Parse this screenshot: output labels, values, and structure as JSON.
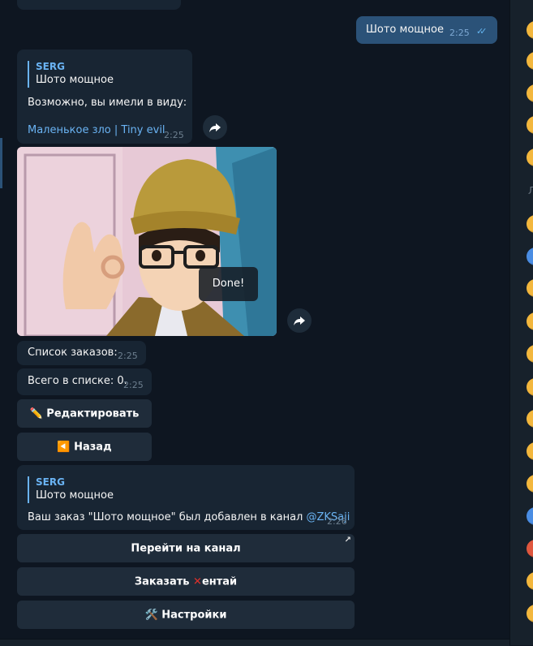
{
  "messages": {
    "out1": {
      "text": "Шото мощное",
      "time": "2:25"
    },
    "bot1": {
      "reply_name": "SERG",
      "reply_text": "Шото мощное",
      "text": "Возможно, вы имели в виду:",
      "link": "Маленькое зло | Tiny evil",
      "time": "2:25"
    },
    "photo": {
      "toast": "Done!"
    },
    "list1": {
      "text": "Список заказов:",
      "time": "2:25"
    },
    "list2": {
      "text": "Всего в списке: 0.",
      "time": "2:25"
    },
    "bot2": {
      "reply_name": "SERG",
      "reply_text": "Шото мощное",
      "text_prefix": "Ваш заказ \"Шото мощное\" был добавлен в канал ",
      "mention": "@ZKSaji",
      "time": "2:26"
    }
  },
  "keyboard1": {
    "edit": "✏️ Редактировать",
    "back": "◀️ Назад"
  },
  "keyboard2": {
    "go_channel": "Перейти на канал",
    "order_prefix": "Заказать ",
    "order_suffix": "ентай",
    "settings": "🛠️ Настройки"
  },
  "side": {
    "letter": "Л"
  },
  "colors": {
    "background": "#0e1621",
    "incoming": "#182533",
    "outgoing": "#2b5278",
    "accent": "#6ab3f3",
    "button": "#1f2c3a"
  }
}
